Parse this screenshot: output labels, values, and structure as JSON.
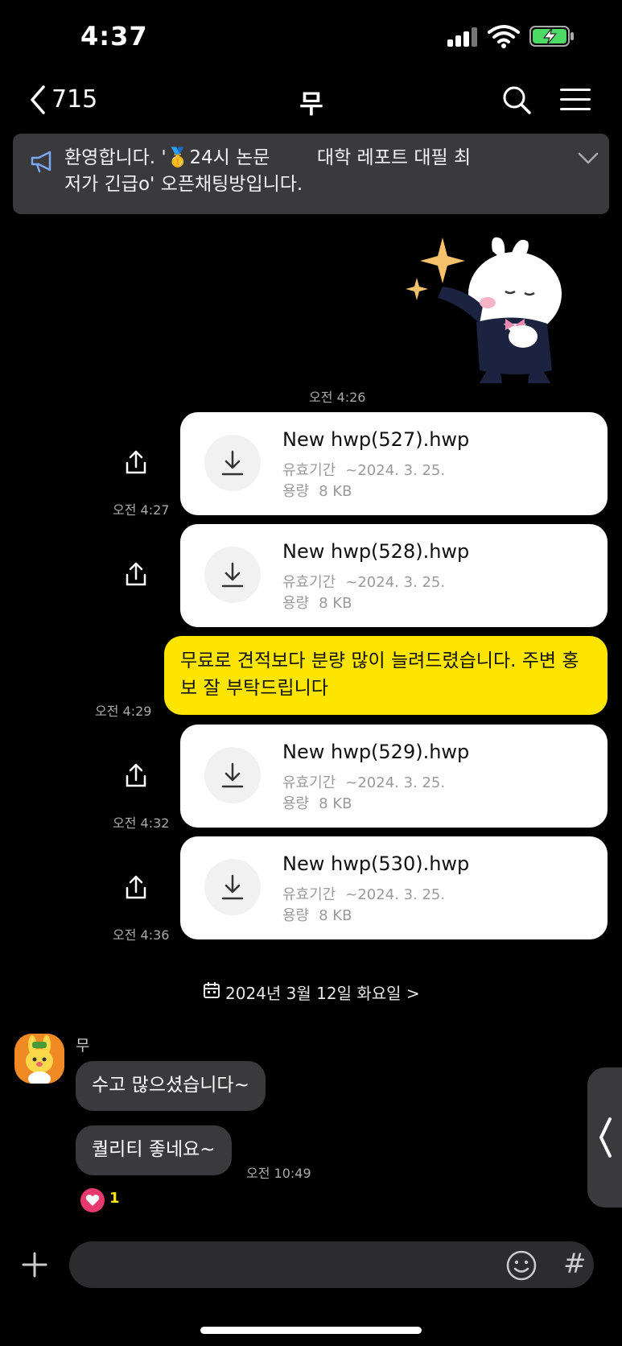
{
  "status_bar": {
    "time": "4:37"
  },
  "header": {
    "back_count": "715",
    "title": "무"
  },
  "notice": {
    "text": "환영합니다. '🥇24시 논문        대학 레포트 대필 최\n저가 긴급o' 오픈채팅방입니다."
  },
  "messages": {
    "sticker_time": "오전 4:26",
    "files": [
      {
        "name": "New hwp(527).hwp",
        "expiry_label": "유효기간",
        "expiry": "~2024. 3. 25.",
        "size_label": "용량",
        "size": "8 KB",
        "time": "오전 4:27"
      },
      {
        "name": "New hwp(528).hwp",
        "expiry_label": "유효기간",
        "expiry": "~2024. 3. 25.",
        "size_label": "용량",
        "size": "8 KB",
        "time": ""
      },
      {
        "name": "New hwp(529).hwp",
        "expiry_label": "유효기간",
        "expiry": "~2024. 3. 25.",
        "size_label": "용량",
        "size": "8 KB",
        "time": "오전 4:32"
      },
      {
        "name": "New hwp(530).hwp",
        "expiry_label": "유효기간",
        "expiry": "~2024. 3. 25.",
        "size_label": "용량",
        "size": "8 KB",
        "time": "오전 4:36"
      }
    ],
    "text_message": {
      "text": "무료로 견적보다 분량 많이 늘려드렸습니다. 주변 홍보 잘 부탁드립니다",
      "time": "오전 4:29"
    }
  },
  "date_divider": "2024년 3월 12일 화요일 >",
  "received": {
    "sender": "무",
    "messages": [
      "수고 많으셨습니다~",
      "퀄리티 좋네요~"
    ],
    "time": "오전 10:49",
    "reaction_count": "1"
  },
  "input": {
    "placeholder": "",
    "hash": "#"
  },
  "icons": {
    "back": "chevron-left-icon",
    "search": "search-icon",
    "menu": "hamburger-menu-icon",
    "notice": "megaphone-icon",
    "download": "download-icon",
    "share": "share-icon",
    "calendar": "calendar-icon",
    "plus": "plus-icon",
    "emoji": "emoji-icon",
    "heart": "heart-icon"
  },
  "colors": {
    "background": "#000000",
    "bubble_yellow": "#fee500",
    "bubble_dark": "#3a3a3c",
    "reaction": "#e8396e"
  }
}
